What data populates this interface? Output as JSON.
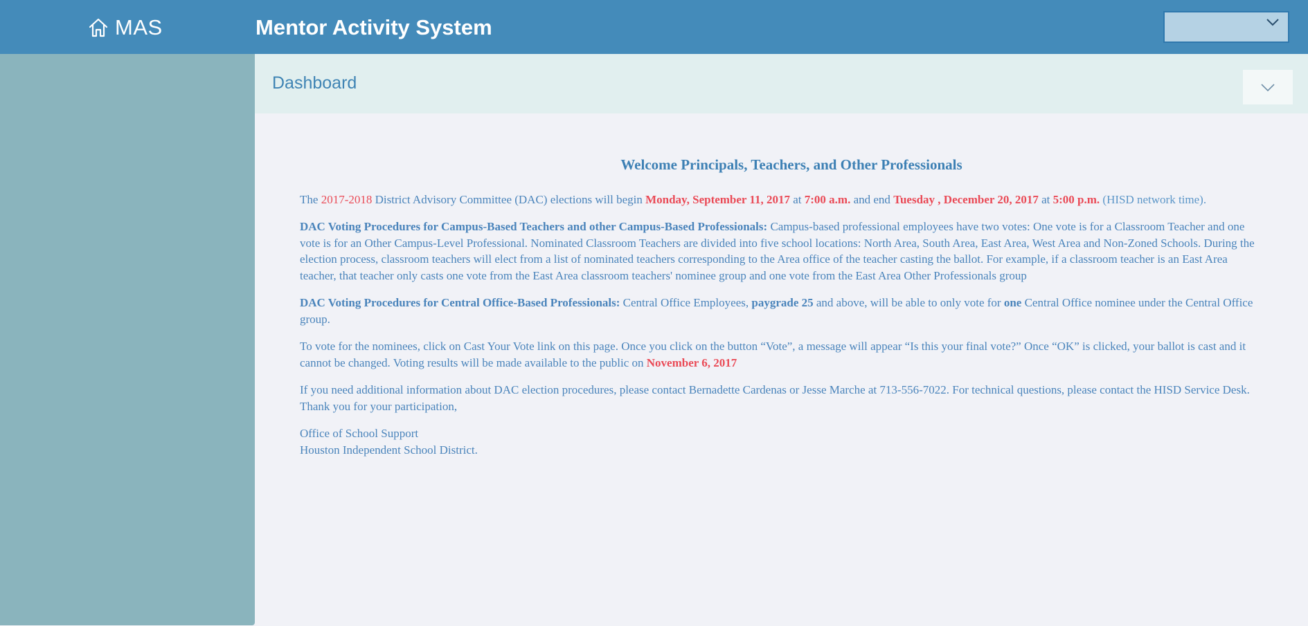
{
  "header": {
    "brand": "MAS",
    "home_icon": "home-icon",
    "title": "Mentor Activity System",
    "user_menu_icon": "chevron-down-icon"
  },
  "page": {
    "title": "Dashboard",
    "collapse_icon": "chevron-down-icon"
  },
  "colors": {
    "header": "#448bba",
    "sidebar": "#8ab4bd",
    "accent_red": "#ea4a56",
    "text_blue": "#4a84bb"
  },
  "announcement": {
    "heading": "Welcome Principals, Teachers, and Other Professionals",
    "p1": {
      "t1": "The ",
      "year": "2017-2018",
      "t2": " District Advisory Committee (DAC) elections will begin ",
      "start_date": "Monday, September 11, 2017",
      "t3": " at ",
      "start_time": "7:00 a.m.",
      "t4": " and end ",
      "end_date": "Tuesday , December 20, 2017",
      "t5": " at ",
      "end_time": "5:00 p.m.",
      "t6": " (HISD network time)."
    },
    "p2": {
      "heading": "DAC Voting Procedures for Campus-Based Teachers and other Campus-Based Professionals:",
      "body": " Campus-based professional employees have two votes: One vote is for a Classroom Teacher and one vote is for an Other Campus-Level Professional. Nominated Classroom Teachers are divided into five school locations: North Area, South Area, East Area, West Area and Non-Zoned Schools. During the election process, classroom teachers will elect from a list of nominated teachers corresponding to the Area office of the teacher casting the ballot. For example, if a classroom teacher is an East Area teacher, that teacher only casts one vote from the East Area classroom teachers' nominee group and one vote from the East Area Other Professionals group"
    },
    "p3": {
      "heading": "DAC Voting Procedures for Central Office-Based Professionals:",
      "t1": " Central Office Employees, ",
      "paygrade": "paygrade 25",
      "t2": " and above, will be able to only vote for ",
      "one": "one",
      "t3": " Central Office nominee under the Central Office group."
    },
    "p4": {
      "t1": "To vote for the nominees, click on Cast Your Vote link on this page. Once you click on the button “Vote”, a message will appear “Is this your final vote?” Once “OK” is clicked, your ballot is cast and it cannot be changed. Voting results will be made available to the public on ",
      "date": "November 6, 2017"
    },
    "p5": {
      "line1": "If you need additional information about DAC election procedures, please contact Bernadette Cardenas or Jesse Marche at 713-556-7022. For technical questions, please contact the HISD Service Desk.",
      "line2": "Thank you for your participation,"
    },
    "signature": {
      "office": "Office of School Support",
      "district": "Houston Independent School District."
    }
  }
}
